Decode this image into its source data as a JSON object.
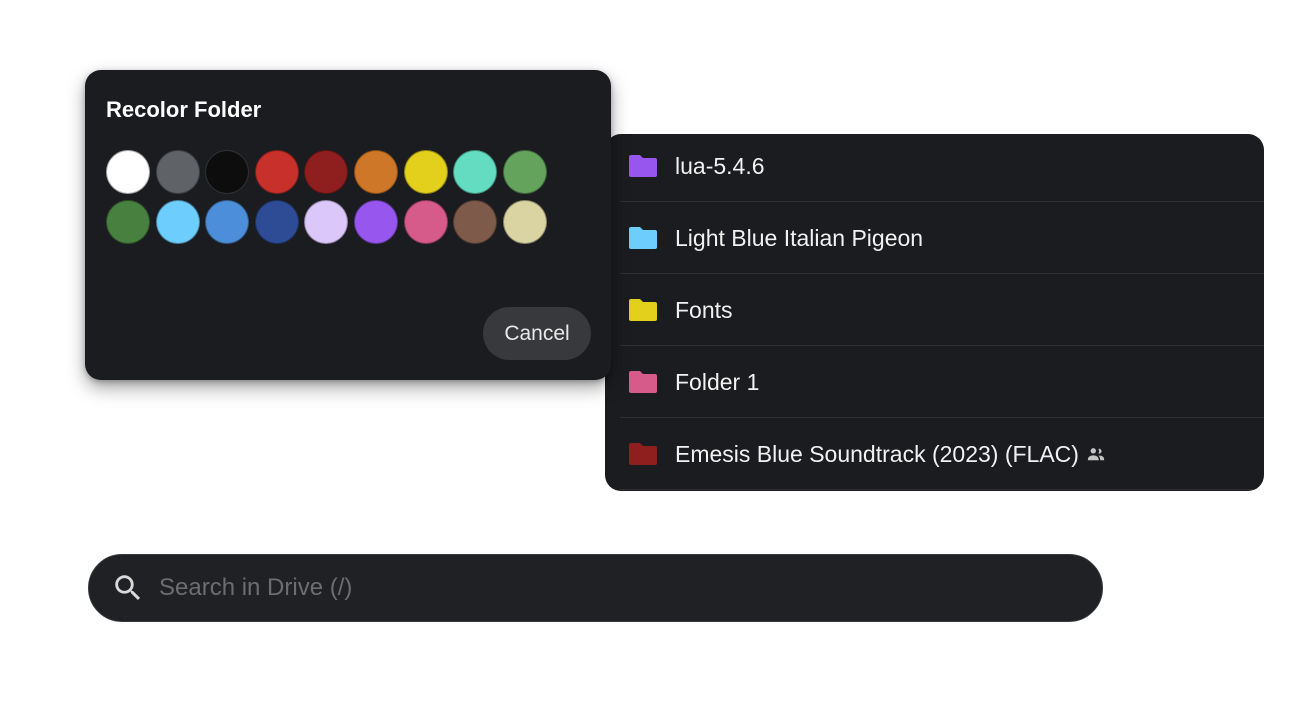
{
  "recolor_dialog": {
    "title": "Recolor Folder",
    "cancel_label": "Cancel",
    "swatches": [
      {
        "name": "white",
        "color": "#ffffff"
      },
      {
        "name": "gray",
        "color": "#5f6368"
      },
      {
        "name": "black",
        "color": "#0d0d0d"
      },
      {
        "name": "red",
        "color": "#c8302b"
      },
      {
        "name": "dark-red",
        "color": "#8f1f1f"
      },
      {
        "name": "orange",
        "color": "#cf7728"
      },
      {
        "name": "yellow",
        "color": "#e2d01d"
      },
      {
        "name": "teal",
        "color": "#63dcc1"
      },
      {
        "name": "green",
        "color": "#63a35c"
      },
      {
        "name": "dark-green",
        "color": "#47803f"
      },
      {
        "name": "light-blue",
        "color": "#6dcdfd"
      },
      {
        "name": "blue",
        "color": "#4c8ed9"
      },
      {
        "name": "navy",
        "color": "#2e4c96"
      },
      {
        "name": "lavender",
        "color": "#dcc7fb"
      },
      {
        "name": "purple",
        "color": "#9756ee"
      },
      {
        "name": "pink",
        "color": "#d65a8a"
      },
      {
        "name": "brown",
        "color": "#7d5a4a"
      },
      {
        "name": "beige",
        "color": "#dad3a2"
      }
    ]
  },
  "folders": [
    {
      "name": "lua-5.4.6",
      "color": "#9756ee",
      "shared": false
    },
    {
      "name": "Light Blue Italian Pigeon",
      "color": "#6dcdfd",
      "shared": false
    },
    {
      "name": "Fonts",
      "color": "#e2d01d",
      "shared": false
    },
    {
      "name": "Folder 1",
      "color": "#d65a8a",
      "shared": false
    },
    {
      "name": "Emesis Blue Soundtrack (2023) (FLAC)",
      "color": "#8f1f1f",
      "shared": true
    }
  ],
  "search": {
    "placeholder": "Search in Drive (/)",
    "value": ""
  }
}
